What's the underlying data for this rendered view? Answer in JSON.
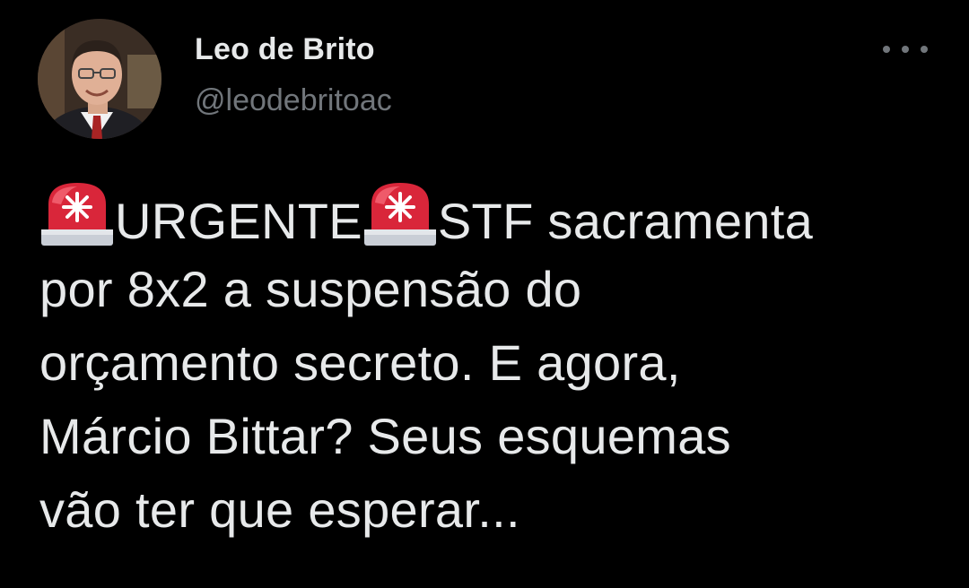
{
  "author": {
    "display_name": "Leo de Brito",
    "handle": "@leodebritoac"
  },
  "more_icon": "more-horizontal-icon",
  "tweet": {
    "urgent_label": "URGENTE",
    "after_second_siren": "STF sacramenta",
    "line2": "por 8x2 a suspensão do",
    "line3": "orçamento secreto. E agora,",
    "line4": "Márcio Bittar? Seus esquemas",
    "line5": "vão ter que esperar..."
  },
  "icons": {
    "emoji": "police-car-light-icon"
  },
  "colors": {
    "background": "#000000",
    "text_primary": "#e7e9ea",
    "text_secondary": "#71767b",
    "siren_red": "#d9263a"
  }
}
